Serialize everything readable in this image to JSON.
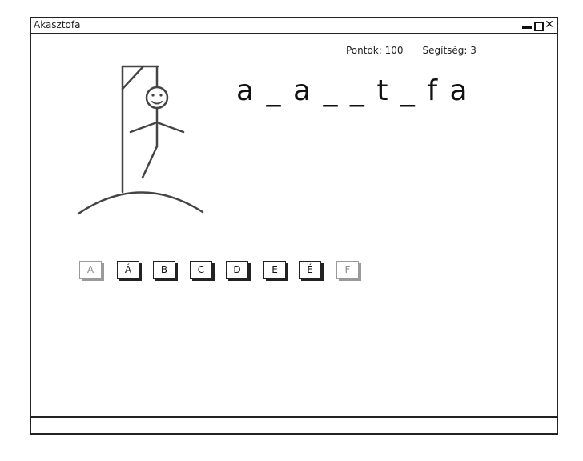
{
  "window": {
    "title": "Akasztofa",
    "controls": {
      "minimize_icon": "minimize-icon",
      "maximize_icon": "maximize-icon",
      "close_icon": "close-icon",
      "close_glyph": "✕"
    }
  },
  "stats": {
    "points_label": "Pontok: 100",
    "help_label": "Segítség: 3"
  },
  "word": {
    "display": "a_a__t_fa"
  },
  "letters": [
    {
      "label": "A",
      "enabled": false
    },
    {
      "label": "Á",
      "enabled": true
    },
    {
      "label": "B",
      "enabled": true
    },
    {
      "label": "C",
      "enabled": true
    },
    {
      "label": "D",
      "enabled": true
    },
    {
      "label": "E",
      "enabled": true
    },
    {
      "label": "É",
      "enabled": true
    },
    {
      "label": "F",
      "enabled": false
    }
  ],
  "colors": {
    "ink": "#222222",
    "disabled": "#9a9a9a"
  }
}
